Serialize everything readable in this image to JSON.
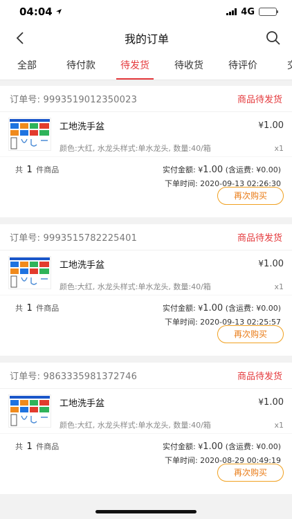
{
  "status": {
    "time": "04:04",
    "network": "4G"
  },
  "nav": {
    "title": "我的订单"
  },
  "tabs": [
    {
      "label": "全部"
    },
    {
      "label": "待付款"
    },
    {
      "label": "待发货",
      "active": true
    },
    {
      "label": "待收货"
    },
    {
      "label": "待评价"
    },
    {
      "label": "交易"
    }
  ],
  "labels": {
    "paid_prefix": "实付金额: ",
    "shipping_prefix": " (含运费: ",
    "time_prefix": "下单时间: ",
    "count_prefix": "共",
    "count_suffix": "件商品",
    "rebuy": "再次购买"
  },
  "orders": [
    {
      "order_no": "订单号: 9993519012350023",
      "status": "商品待发货",
      "name": "工地洗手盆",
      "price_symbol": "¥",
      "price": "1.00",
      "spec": "颜色:大红, 水龙头样式:单水龙头, 数量:40/箱",
      "qty": "x1",
      "count": "1",
      "paid": "1.00",
      "shipping": "¥0.00)",
      "time": "2020-09-13 02:26:30"
    },
    {
      "order_no": "订单号: 9993515782225401",
      "status": "商品待发货",
      "name": "工地洗手盆",
      "price_symbol": "¥",
      "price": "1.00",
      "spec": "颜色:大红, 水龙头样式:单水龙头, 数量:40/箱",
      "qty": "x1",
      "count": "1",
      "paid": "1.00",
      "shipping": "¥0.00)",
      "time": "2020-09-13 02:25:57"
    },
    {
      "order_no": "订单号: 9863335981372746",
      "status": "商品待发货",
      "name": "工地洗手盆",
      "price_symbol": "¥",
      "price": "1.00",
      "spec": "颜色:大红, 水龙头样式:单水龙头, 数量:40/箱",
      "qty": "x1",
      "count": "1",
      "paid": "1.00",
      "shipping": "¥0.00)",
      "time": "2020-08-29 00:49:19"
    }
  ],
  "colors": {
    "accent": "#e4393c",
    "button": "#e97a14"
  }
}
